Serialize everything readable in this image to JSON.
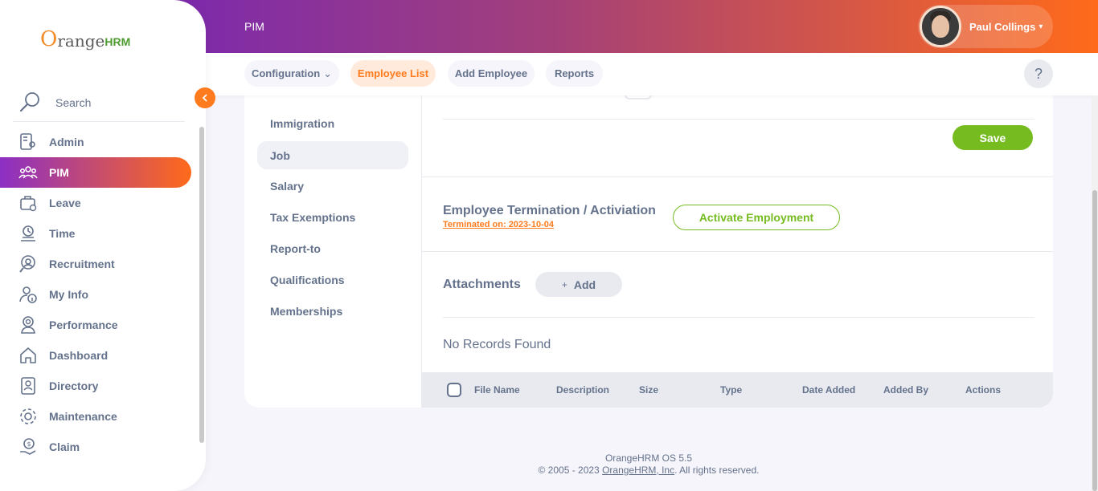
{
  "app": {
    "brand": {
      "o": "O",
      "range": "range",
      "hrm": "HRM"
    },
    "colors": {
      "accent": "#ff7b1d",
      "success": "#76bc21",
      "text": "#64728c",
      "gradient_start": "#6a1fc4",
      "gradient_end": "#ff6a1a"
    }
  },
  "sidebar": {
    "search_label": "Search",
    "items": [
      {
        "label": "Admin",
        "icon": "admin-icon"
      },
      {
        "label": "PIM",
        "icon": "pim-icon",
        "active": true
      },
      {
        "label": "Leave",
        "icon": "leave-icon"
      },
      {
        "label": "Time",
        "icon": "time-icon"
      },
      {
        "label": "Recruitment",
        "icon": "recruitment-icon"
      },
      {
        "label": "My Info",
        "icon": "my-info-icon"
      },
      {
        "label": "Performance",
        "icon": "performance-icon"
      },
      {
        "label": "Dashboard",
        "icon": "dashboard-icon"
      },
      {
        "label": "Directory",
        "icon": "directory-icon"
      },
      {
        "label": "Maintenance",
        "icon": "maintenance-icon"
      },
      {
        "label": "Claim",
        "icon": "claim-icon"
      }
    ]
  },
  "header": {
    "module_title": "PIM",
    "user_name": "Paul Collings",
    "caret": "▾"
  },
  "topnav": {
    "tabs": [
      {
        "label": "Configuration",
        "has_caret": true,
        "caret": "⌄"
      },
      {
        "label": "Employee List",
        "active": true
      },
      {
        "label": "Add Employee"
      },
      {
        "label": "Reports"
      }
    ],
    "help_label": "?"
  },
  "profile_tabs": {
    "items": [
      {
        "label": "Immigration"
      },
      {
        "label": "Job",
        "active": true
      },
      {
        "label": "Salary"
      },
      {
        "label": "Tax Exemptions"
      },
      {
        "label": "Report-to"
      },
      {
        "label": "Qualifications"
      },
      {
        "label": "Memberships"
      }
    ]
  },
  "job": {
    "save_label": "Save",
    "termination": {
      "title": "Employee Termination / Activiation",
      "status_text": "Terminated on: 2023-10-04",
      "activate_label": "Activate Employment"
    },
    "attachments": {
      "title": "Attachments",
      "add_label": "Add",
      "add_glyph": "+",
      "empty_text": "No Records Found",
      "columns": [
        "File Name",
        "Description",
        "Size",
        "Type",
        "Date Added",
        "Added By",
        "Actions"
      ]
    }
  },
  "footer": {
    "version": "OrangeHRM OS 5.5",
    "copyright_prefix": "© 2005 - 2023 ",
    "company_link": "OrangeHRM, Inc",
    "copyright_suffix": ". All rights reserved."
  }
}
